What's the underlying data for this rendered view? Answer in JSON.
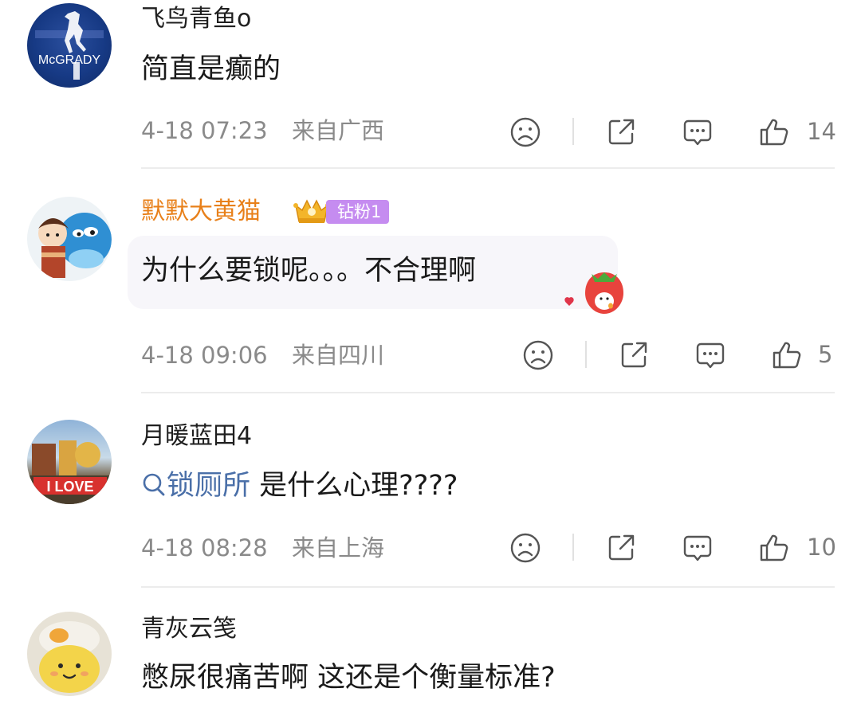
{
  "comments": [
    {
      "avatar_label": "McGRADY",
      "username": "飞鸟青鱼o",
      "content": "简直是癫的",
      "time": "4-18 07:23",
      "location": "来自广西",
      "likes": "14"
    },
    {
      "username": "默默大黄猫",
      "badge": "钻粉1",
      "content": "为什么要锁呢。。。不合理啊",
      "time": "4-18 09:06",
      "location": "来自四川",
      "likes": "5"
    },
    {
      "avatar_label": "I LOVE",
      "username": "月暖蓝田4",
      "content_tag": "锁厕所",
      "content": " 是什么心理????",
      "time": "4-18 08:28",
      "location": "来自上海",
      "likes": "10"
    },
    {
      "username": "青灰云笺",
      "content": "憋尿很痛苦啊 这还是个衡量标准?"
    }
  ],
  "icons": {
    "dislike": "sad-face-icon",
    "share": "share-icon",
    "comment": "comment-icon",
    "like": "thumbs-up-icon",
    "search": "search-icon",
    "crown": "crown-icon",
    "sticker": "strawberry-sticker-icon"
  },
  "colors": {
    "vip_username": "#e8801a",
    "badge": "#c58cf0",
    "meta_text": "#8a8a8a",
    "tag_link": "#4a6fa8"
  }
}
